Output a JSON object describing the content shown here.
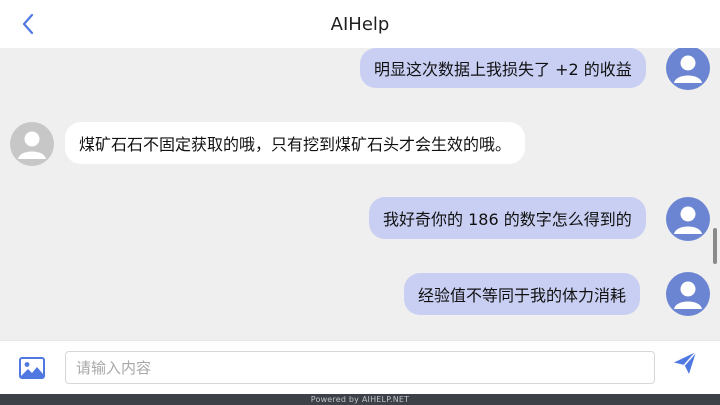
{
  "header": {
    "title": "AIHelp",
    "back_icon": "chevron-left-icon"
  },
  "messages": [
    {
      "from": "user",
      "text": "明显这次数据上我损失了 +2 的收益"
    },
    {
      "from": "bot",
      "text": "煤矿石石不固定获取的哦，只有挖到煤矿石头才会生效的哦。"
    },
    {
      "from": "user",
      "text": "我好奇你的 186 的数字怎么得到的"
    },
    {
      "from": "user",
      "text": "经验值不等同于我的体力消耗"
    }
  ],
  "input": {
    "placeholder": "请输入内容",
    "value": "",
    "image_icon": "image-icon",
    "send_icon": "send-icon"
  },
  "footer": {
    "text": "Powered by AIHELP.NET"
  },
  "colors": {
    "accent": "#4f78e0",
    "user_bubble": "#c9cff3",
    "bot_bubble": "#ffffff",
    "user_avatar": "#6c85d3",
    "bot_avatar": "#c7c7c7",
    "background": "#efefef"
  }
}
